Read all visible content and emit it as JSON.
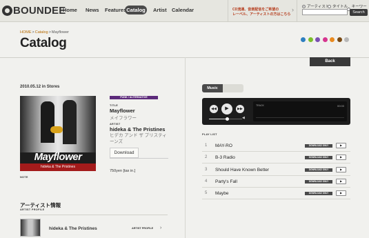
{
  "header": {
    "logo_text": "BOUNDEE",
    "nav": [
      "Home",
      "News",
      "Features",
      "Catalog",
      "Artist",
      "Calendar"
    ],
    "promo_line1": "CD流通、音楽配信をご希望の",
    "promo_line2": "レーベル、アーティストの方はこちら",
    "search_options": [
      "アーティスト",
      "タイトル",
      "キーワード"
    ],
    "search_button": "Search",
    "search_value": ""
  },
  "breadcrumb": {
    "home": "HOME",
    "sep": ">",
    "catalog": "Catalog",
    "current": "Mayflower"
  },
  "page_title": "Catalog",
  "color_dots": [
    "#2e7fc0",
    "#7bbf2a",
    "#7a4fb2",
    "#d6358f",
    "#e98a1f",
    "#7a4a14",
    "#b8b8b8"
  ],
  "back_button": "Back",
  "release": {
    "date_text": "2010.05.12 in Stores",
    "cover_title": "Mayflower",
    "cover_artist": "hideka & The Pristines",
    "genre": "FUNK / ALTERNATIVE",
    "title_label": "TITLE",
    "title": "Mayflower",
    "title_kana": "メイフラワー",
    "artist_label": "ARTIST",
    "artist": "hideka & The Pristines",
    "artist_kana": "ヒデカ アンド ザ プリスティーンズ",
    "download_label": "Download",
    "price": "750yen [tax in.]",
    "note_label": "NOTE"
  },
  "artist_info": {
    "title": "アーティスト情報",
    "subtitle": "ARTIST PROFILE",
    "name": "hideka & The Pristines",
    "link_label": "ARTIST PROFILE",
    "arrow": "›"
  },
  "player": {
    "tab_label": "Music",
    "track_label": "TRACK",
    "time": "00:00",
    "seek_fraction": 0.55,
    "prev": "◀◀",
    "play": "▶",
    "next": "▶▶",
    "volume_icon": "◀"
  },
  "playlist": {
    "label": "PLAY LIST",
    "badge": "DOWNLOAD ONLY",
    "play_glyph": "▶",
    "tracks": [
      {
        "num": "1",
        "title": "MAY-RO"
      },
      {
        "num": "2",
        "title": "B-3 Radio"
      },
      {
        "num": "3",
        "title": "Should Have Known Better"
      },
      {
        "num": "4",
        "title": "Party's Fall"
      },
      {
        "num": "5",
        "title": "Maybe"
      }
    ]
  }
}
